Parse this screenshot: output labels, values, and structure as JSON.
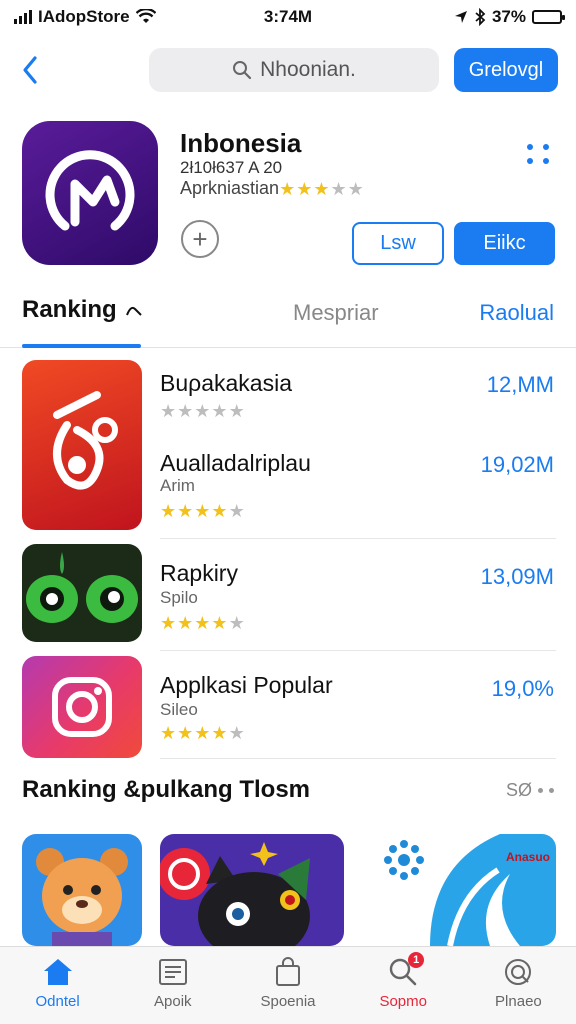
{
  "status_bar": {
    "carrier": "IAdopStore",
    "time": "3:74M",
    "battery": "37%",
    "battery_level": 0.37
  },
  "header": {
    "search_placeholder": "Nhoonian.",
    "button_label": "Grelovgl"
  },
  "app": {
    "title": "Inbonesia",
    "date": "2ł10ł637 A 20",
    "subtitle": "Aprkniastian",
    "rating": 3,
    "rating_max": 5,
    "outline_button": "Lsw",
    "fill_button": "Eiikc"
  },
  "tabs": [
    {
      "label": "Ranking"
    },
    {
      "label": "Mespriar"
    },
    {
      "label": "Raolual"
    }
  ],
  "list": [
    {
      "title": "Buρakakasia",
      "subtitle": "",
      "rating": 0,
      "value": "12,MM"
    },
    {
      "title": "Aualladalriplau",
      "subtitle": "Arim",
      "rating": 3.5,
      "value": "19,02M"
    },
    {
      "title": "Rapkiry",
      "subtitle": "Spilo",
      "rating": 4,
      "value": "13,09M"
    },
    {
      "title": "Applkasi Popular",
      "subtitle": "Sileo",
      "rating": 3.5,
      "value": "19,0%"
    }
  ],
  "section": {
    "title": "Ranking &pulkang Tlosm",
    "more": "SØ"
  },
  "featured_text": "Anasuo",
  "tab_bar": [
    {
      "label": "Odntel",
      "icon": "home-icon",
      "active": true
    },
    {
      "label": "Apoik",
      "icon": "news-icon"
    },
    {
      "label": "Spoenia",
      "icon": "bag-icon"
    },
    {
      "label": "Sopmo",
      "icon": "search-icon",
      "badge": "1"
    },
    {
      "label": "Plnaeo",
      "icon": "globe-icon"
    }
  ],
  "colors": {
    "accent": "#1a7cf0",
    "star": "#f2c21b",
    "alert": "#e8263a"
  }
}
